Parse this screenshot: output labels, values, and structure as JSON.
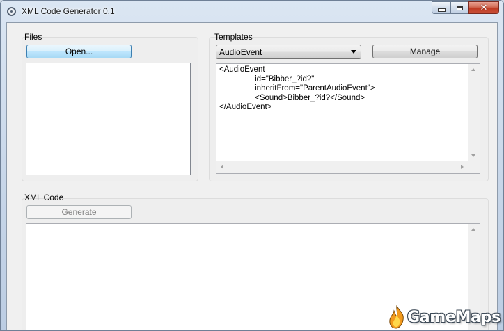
{
  "window": {
    "title": "XML Code Generator 0.1",
    "caption_buttons": {
      "minimize": "minimize-icon",
      "maximize": "maximize-icon",
      "close": "✕"
    }
  },
  "files": {
    "label": "Files",
    "open_button": "Open...",
    "items": []
  },
  "templates": {
    "label": "Templates",
    "selected": "AudioEvent",
    "manage_button": "Manage",
    "code_lines": [
      "<AudioEvent",
      "\t\tid=\"Bibber_?id?\"",
      "\t\tinheritFrom=\"ParentAudioEvent\">",
      "\t\t<Sound>Bibber_?id?</Sound>",
      "</AudioEvent>"
    ]
  },
  "xml_code": {
    "label": "XML Code",
    "generate_button": "Generate",
    "content": ""
  },
  "watermark": {
    "text": "GameMaps"
  },
  "colors": {
    "window_frame": "#c6d5e8",
    "client_bg": "#f0f0f0",
    "close_button": "#c8513a",
    "focus_button": "#bee6fd"
  }
}
